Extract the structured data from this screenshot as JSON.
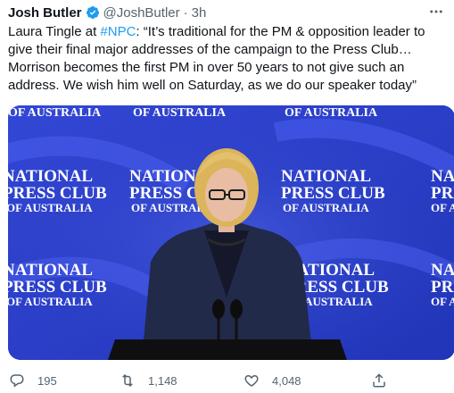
{
  "tweet": {
    "author_name": "Josh Butler",
    "handle": "@JoshButler",
    "separator": "·",
    "time": "3h",
    "text_before": "Laura Tingle at ",
    "hashtag": "#NPC",
    "text_after": ": “It’s traditional for the PM & opposition leader to give their final major addresses of the campaign to the Press Club… Morrison becomes the first PM in over 50 years to not give such an address. We wish him well on Saturday, as we do our speaker today”"
  },
  "media": {
    "backdrop_lines": [
      "NATIONAL",
      "PRESS CLUB",
      "OF AUSTRALIA"
    ],
    "backdrop_color": "#2a3fc9",
    "podium_color": "#111111"
  },
  "actions": {
    "reply_count": "195",
    "retweet_count": "1,148",
    "like_count": "4,048"
  },
  "colors": {
    "text": "#0f1419",
    "secondary": "#536471",
    "link": "#1d9bf0",
    "verified": "#1d9bf0"
  },
  "icons": {
    "verified": "verified-badge-icon",
    "more": "more-dots-icon",
    "reply": "reply-icon",
    "retweet": "retweet-icon",
    "like": "heart-icon",
    "share": "share-icon"
  }
}
